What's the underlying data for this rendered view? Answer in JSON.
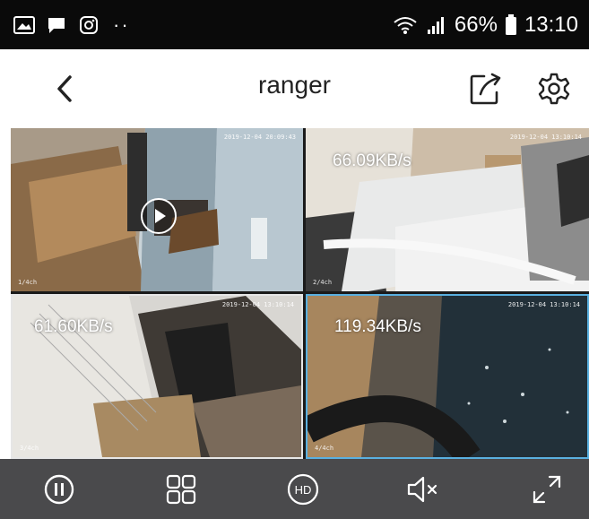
{
  "status_bar": {
    "battery_percent": "66%",
    "time": "13:10",
    "dots": "··",
    "icons": [
      "gallery-notification-icon",
      "message-icon",
      "instagram-icon",
      "wifi-icon",
      "signal-icon",
      "battery-icon"
    ]
  },
  "header": {
    "title": "ranger",
    "icons": [
      "back-icon",
      "share-icon",
      "settings-icon"
    ]
  },
  "cameras": [
    {
      "speed": "",
      "timestamp": "2019-12-04 20:09:43",
      "label": "1/4ch",
      "paused": true
    },
    {
      "speed": "66.09KB/s",
      "timestamp": "2019-12-04 13:10:14",
      "label": "2/4ch"
    },
    {
      "speed": "61.60KB/s",
      "timestamp": "2019-12-04 13:10:14",
      "label": "3/4ch"
    },
    {
      "speed": "119.34KB/s",
      "timestamp": "2019-12-04 13:10:14",
      "label": "4/4ch"
    }
  ],
  "toolbar": {
    "hd_label": "HD",
    "icons": [
      "pause-icon",
      "grid-layout-icon",
      "hd-icon",
      "mute-icon",
      "fullscreen-icon"
    ]
  },
  "colors": {
    "status_bar_bg": "#0a0a0a",
    "toolbar_bg": "#4a4a4c",
    "selected_border": "#5ab0e0"
  }
}
